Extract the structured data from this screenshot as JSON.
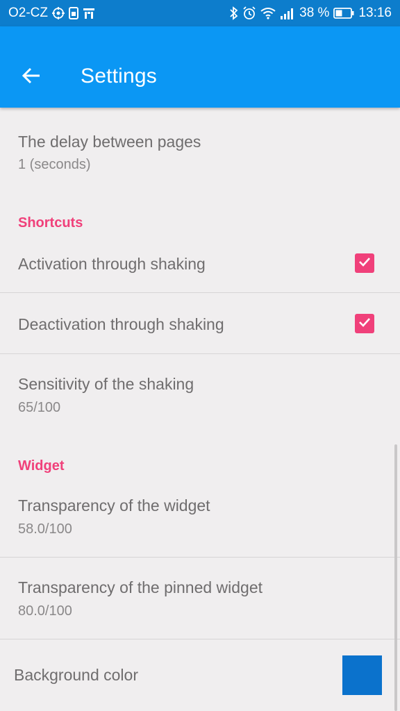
{
  "status_bar": {
    "carrier": "O2-CZ",
    "battery_percent": "38 %",
    "time": "13:16"
  },
  "app_bar": {
    "title": "Settings",
    "back_icon": "arrow-left-icon"
  },
  "preferences": {
    "delay": {
      "title": "The delay between pages",
      "summary": "1 (seconds)"
    },
    "shortcuts_category": "Shortcuts",
    "activation": {
      "title": "Activation through shaking",
      "checked": true
    },
    "deactivation": {
      "title": "Deactivation through shaking",
      "checked": true
    },
    "sensitivity": {
      "title": "Sensitivity of the shaking",
      "summary": "65/100"
    },
    "widget_category": "Widget",
    "widget_transparency": {
      "title": "Transparency of the widget",
      "summary": "58.0/100"
    },
    "pinned_transparency": {
      "title": "Transparency of the pinned widget",
      "summary": "80.0/100"
    },
    "background_color": {
      "title": "Background color",
      "color": "#0b72cc"
    }
  },
  "colors": {
    "status_bar": "#0d7dcc",
    "app_bar": "#0b97f4",
    "accent": "#f0407a",
    "background": "#f0eeef"
  }
}
